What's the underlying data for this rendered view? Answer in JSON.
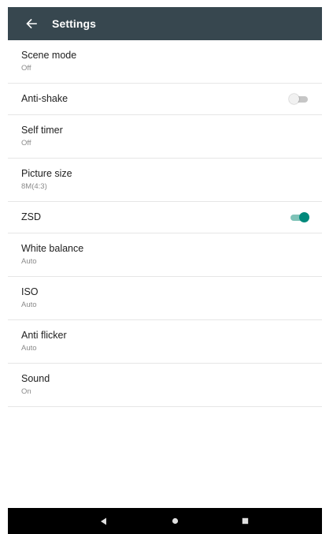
{
  "header": {
    "back_icon": "arrow-back-icon",
    "title": "Settings"
  },
  "settings": [
    {
      "title": "Scene mode",
      "value": "Off"
    },
    {
      "title": "Anti-shake",
      "toggle": false
    },
    {
      "title": "Self timer",
      "value": "Off"
    },
    {
      "title": "Picture size",
      "value": "8M(4:3)"
    },
    {
      "title": "ZSD",
      "toggle": true
    },
    {
      "title": "White balance",
      "value": "Auto"
    },
    {
      "title": "ISO",
      "value": "Auto"
    },
    {
      "title": "Anti flicker",
      "value": "Auto"
    },
    {
      "title": "Sound",
      "value": "On"
    }
  ],
  "navbar": {
    "back_icon": "triangle-back-icon",
    "home_icon": "circle-home-icon",
    "recents_icon": "square-recents-icon"
  },
  "colors": {
    "appbar": "#37474f",
    "accent": "#00897b",
    "navbar": "#000000"
  }
}
